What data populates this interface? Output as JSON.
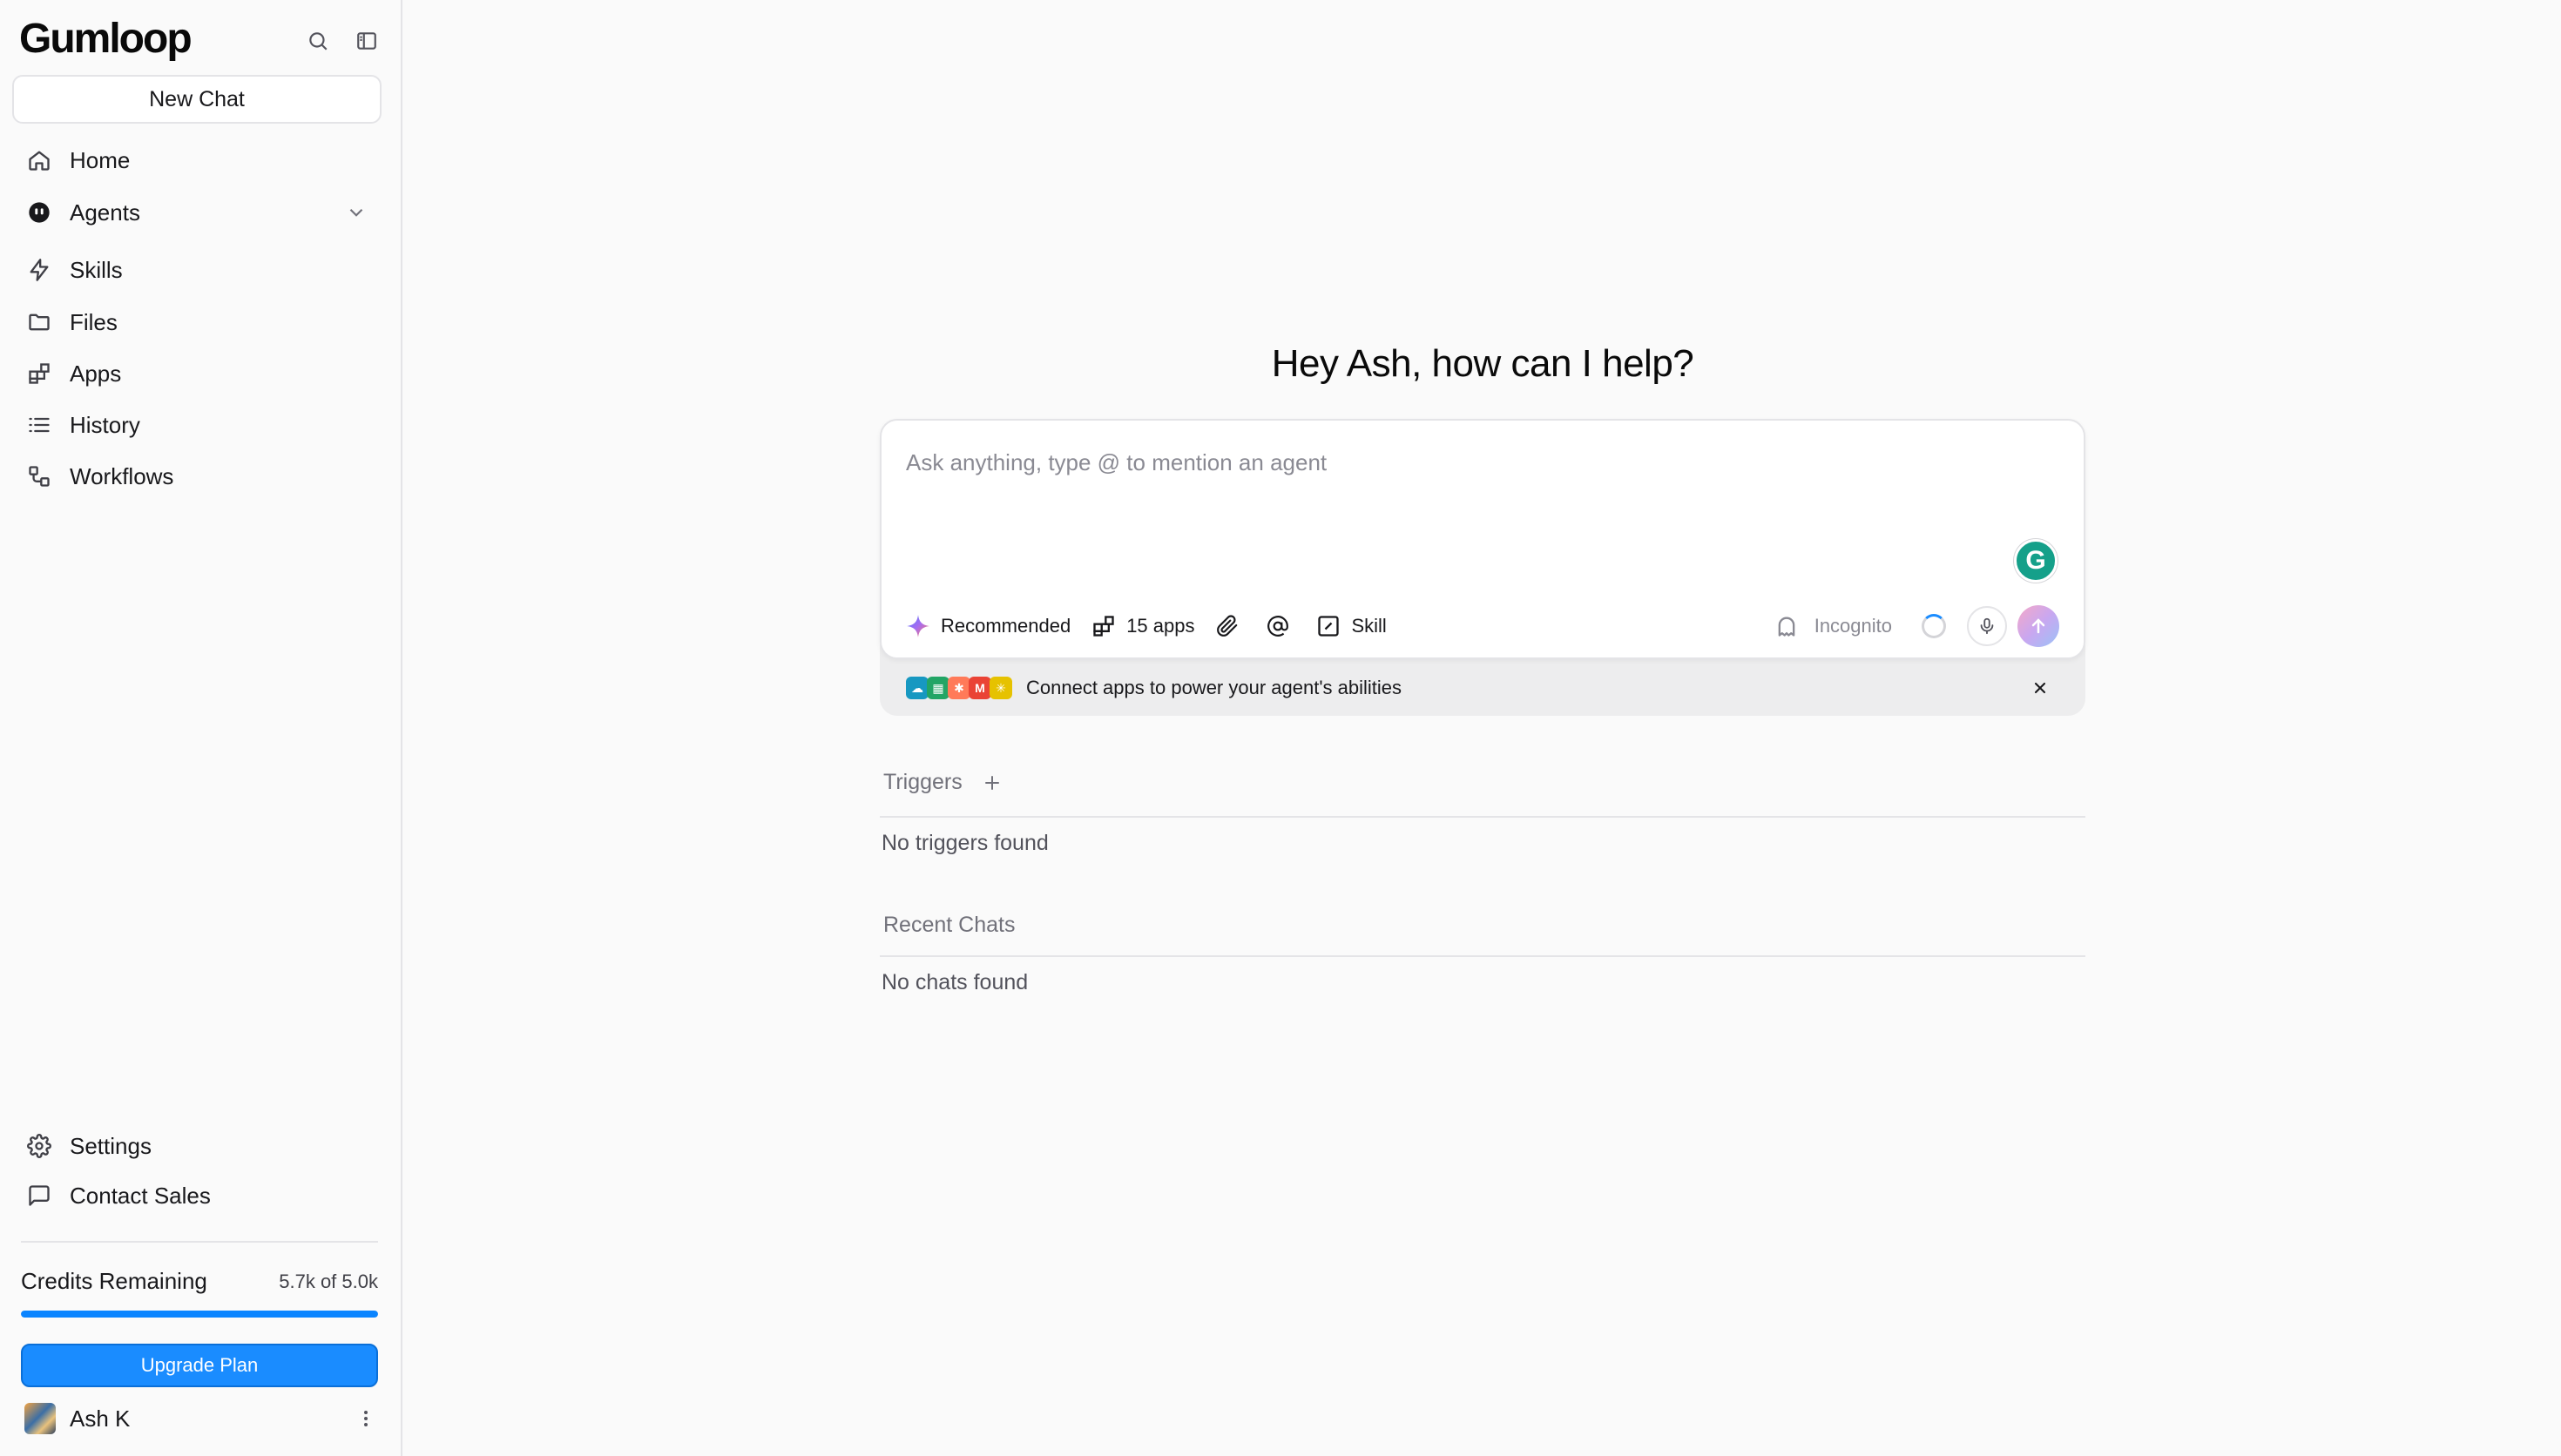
{
  "brand": {
    "logo_text": "Gumloop"
  },
  "sidebar": {
    "new_chat_label": "New Chat",
    "nav": [
      {
        "label": "Home",
        "icon": "home-icon"
      },
      {
        "label": "Agents",
        "icon": "agents-icon"
      },
      {
        "label": "Skills",
        "icon": "lightning-icon"
      },
      {
        "label": "Files",
        "icon": "folder-icon"
      },
      {
        "label": "Apps",
        "icon": "apps-icon"
      },
      {
        "label": "History",
        "icon": "list-icon"
      },
      {
        "label": "Workflows",
        "icon": "workflow-icon"
      }
    ],
    "bottom_nav": [
      {
        "label": "Settings",
        "icon": "gear-icon"
      },
      {
        "label": "Contact Sales",
        "icon": "message-icon"
      }
    ],
    "credits": {
      "label": "Credits Remaining",
      "value_text": "5.7k of 5.0k",
      "progress_percent": 100
    },
    "upgrade_label": "Upgrade Plan",
    "user": {
      "name": "Ash K"
    }
  },
  "main": {
    "greeting": "Hey Ash, how can I help?",
    "composer": {
      "placeholder": "Ask anything, type @ to mention an agent",
      "value": "",
      "recommended_label": "Recommended",
      "apps_label": "15 apps",
      "skill_label": "Skill",
      "incognito_label": "Incognito"
    },
    "connect_banner": {
      "text": "Connect apps to power your agent's abilities",
      "app_icons": [
        "salesforce",
        "google-sheets",
        "hubspot",
        "gmail",
        "zapier"
      ]
    },
    "triggers": {
      "title": "Triggers",
      "empty_text": "No triggers found"
    },
    "recent_chats": {
      "title": "Recent Chats",
      "empty_text": "No chats found"
    }
  },
  "colors": {
    "accent": "#1a8cff",
    "background": "#fafafa",
    "border": "#e4e4e7",
    "muted_text": "#71717a"
  }
}
